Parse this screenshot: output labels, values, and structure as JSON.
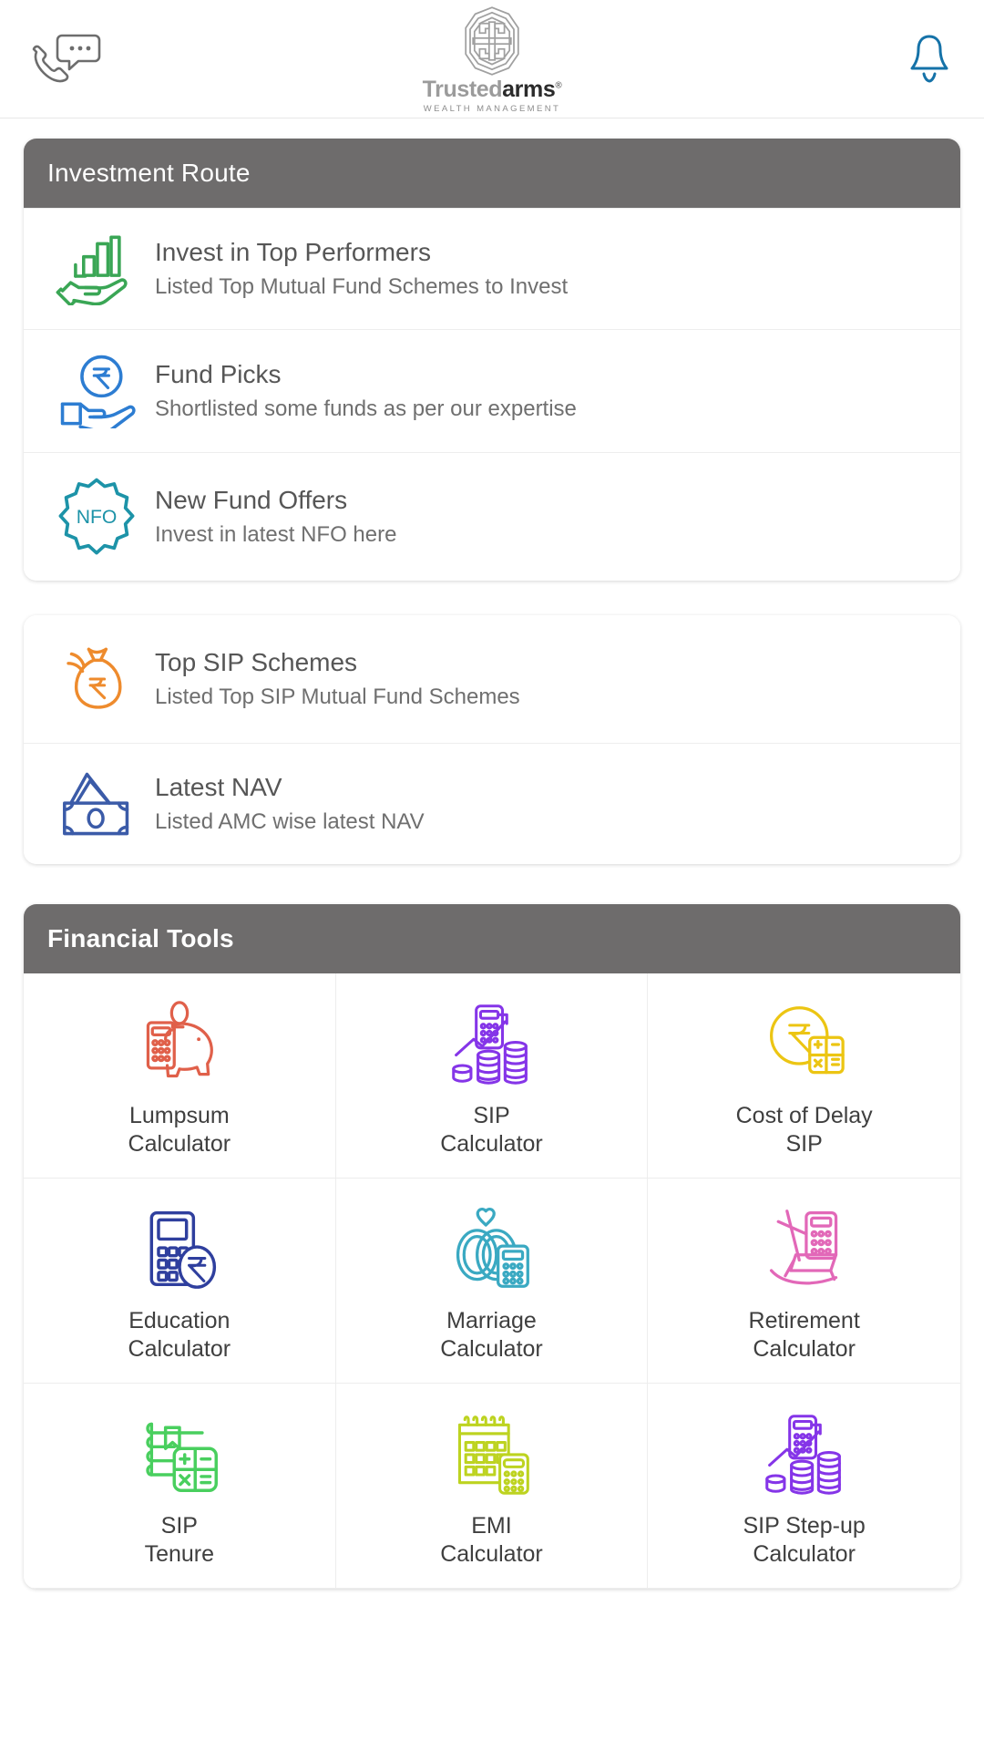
{
  "header": {
    "support_icon": "phone-chat-icon",
    "notification_icon": "bell-icon",
    "brand_part1": "Trusted",
    "brand_part2": "arms",
    "brand_registered": "®",
    "brand_tagline": "WEALTH MANAGEMENT",
    "logo_icon": "trustedarms-emblem-icon"
  },
  "investment_route": {
    "title": "Investment Route",
    "items": [
      {
        "title": "Invest in Top Performers",
        "subtitle": "Listed Top Mutual Fund Schemes to Invest",
        "icon": "hand-bar-chart-icon",
        "color": "#3aa655"
      },
      {
        "title": "Fund Picks",
        "subtitle": "Shortlisted some funds as per our expertise",
        "icon": "hand-rupee-coin-icon",
        "color": "#2d7dd2"
      },
      {
        "title": "New Fund Offers",
        "subtitle": "Invest in latest NFO here",
        "icon": "nfo-badge-icon",
        "badge_text": "NFO",
        "color": "#1d93a8"
      }
    ]
  },
  "secondary_list": {
    "items": [
      {
        "title": "Top SIP Schemes",
        "subtitle": "Listed Top SIP Mutual Fund Schemes",
        "icon": "money-bag-rupee-icon",
        "color": "#ee8b2d"
      },
      {
        "title": "Latest NAV",
        "subtitle": "Listed AMC wise latest NAV",
        "icon": "banknotes-icon",
        "color": "#3b5ba8"
      }
    ]
  },
  "financial_tools": {
    "title": "Financial Tools",
    "items": [
      {
        "label": "Lumpsum\nCalculator",
        "icon": "piggy-bank-calculator-icon",
        "color": "#e0604a"
      },
      {
        "label": "SIP\nCalculator",
        "icon": "calculator-coins-arrow-icon",
        "color": "#8535e8"
      },
      {
        "label": "Cost of Delay\nSIP",
        "icon": "rupee-coin-calculator-icon",
        "color": "#ecc513"
      },
      {
        "label": "Education\nCalculator",
        "icon": "calculator-rupee-coin-icon",
        "color": "#2f3f9e"
      },
      {
        "label": "Marriage\nCalculator",
        "icon": "rings-heart-calculator-icon",
        "color": "#3aa9c2"
      },
      {
        "label": "Retirement\nCalculator",
        "icon": "rocking-chair-icon",
        "color": "#e268b8"
      },
      {
        "label": "SIP\nTenure",
        "icon": "book-calculator-icon",
        "color": "#49cf5e"
      },
      {
        "label": "EMI\nCalculator",
        "icon": "calendar-calculator-icon",
        "color": "#bdd320"
      },
      {
        "label": "SIP Step-up\nCalculator",
        "icon": "calculator-coins-arrow-icon",
        "color": "#8535e8"
      }
    ]
  },
  "theme": {
    "header_bar": "#6e6c6c",
    "page_bg": "#ffffff",
    "title_text": "#565656",
    "sub_text": "#6f6f6f"
  }
}
